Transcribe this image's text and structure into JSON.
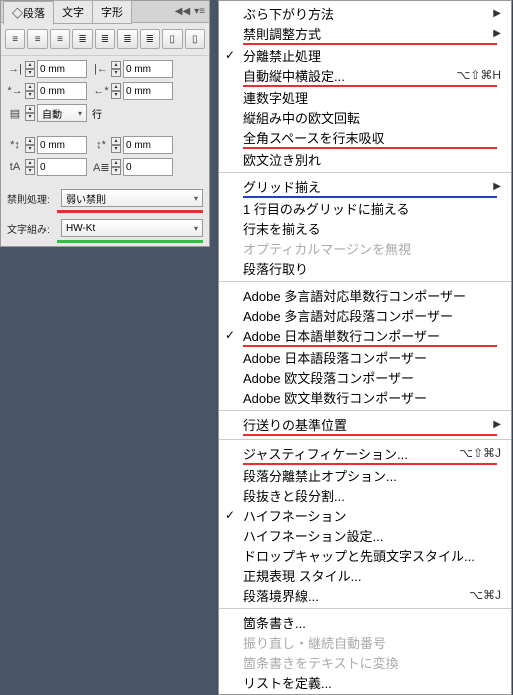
{
  "tabs": {
    "t1": "段落",
    "t2": "文字",
    "t3": "字形"
  },
  "fields": {
    "v1": "0 mm",
    "v2": "0 mm",
    "v3": "0 mm",
    "v4": "0 mm",
    "auto": "自動",
    "unit": "行",
    "v5": "0 mm",
    "v6": "0 mm",
    "v7": "0",
    "v8": "0"
  },
  "sel1": {
    "label": "禁則処理:",
    "value": "弱い禁則"
  },
  "sel2": {
    "label": "文字組み:",
    "value": "HW-Kt"
  },
  "menu": {
    "m1": "ぶら下がり方法",
    "m2": "禁則調整方式",
    "m3": "分離禁止処理",
    "m4": "自動縦中横設定...",
    "s4": "⌥⇧⌘H",
    "m5": "連数字処理",
    "m6": "縦組み中の欧文回転",
    "m7": "全角スペースを行末吸収",
    "m8": "欧文泣き別れ",
    "m9": "グリッド揃え",
    "m10": "1 行目のみグリッドに揃える",
    "m11": "行末を揃える",
    "m12": "オプティカルマージンを無視",
    "m13": "段落行取り",
    "m14": "Adobe 多言語対応単数行コンポーザー",
    "m15": "Adobe 多言語対応段落コンポーザー",
    "m16": "Adobe 日本語単数行コンポーザー",
    "m17": "Adobe 日本語段落コンポーザー",
    "m18": "Adobe 欧文段落コンポーザー",
    "m19": "Adobe 欧文単数行コンポーザー",
    "m20": "行送りの基準位置",
    "m21": "ジャスティフィケーション...",
    "s21": "⌥⇧⌘J",
    "m22": "段落分離禁止オプション...",
    "m23": "段抜きと段分割...",
    "m24": "ハイフネーション",
    "m25": "ハイフネーション設定...",
    "m26": "ドロップキャップと先頭文字スタイル...",
    "m27": "正規表現 スタイル...",
    "m28": "段落境界線...",
    "s28": "⌥⌘J",
    "m29": "箇条書き...",
    "m30": "振り直し・継続自動番号",
    "m31": "箇条書きをテキストに変換",
    "m32": "リストを定義..."
  }
}
